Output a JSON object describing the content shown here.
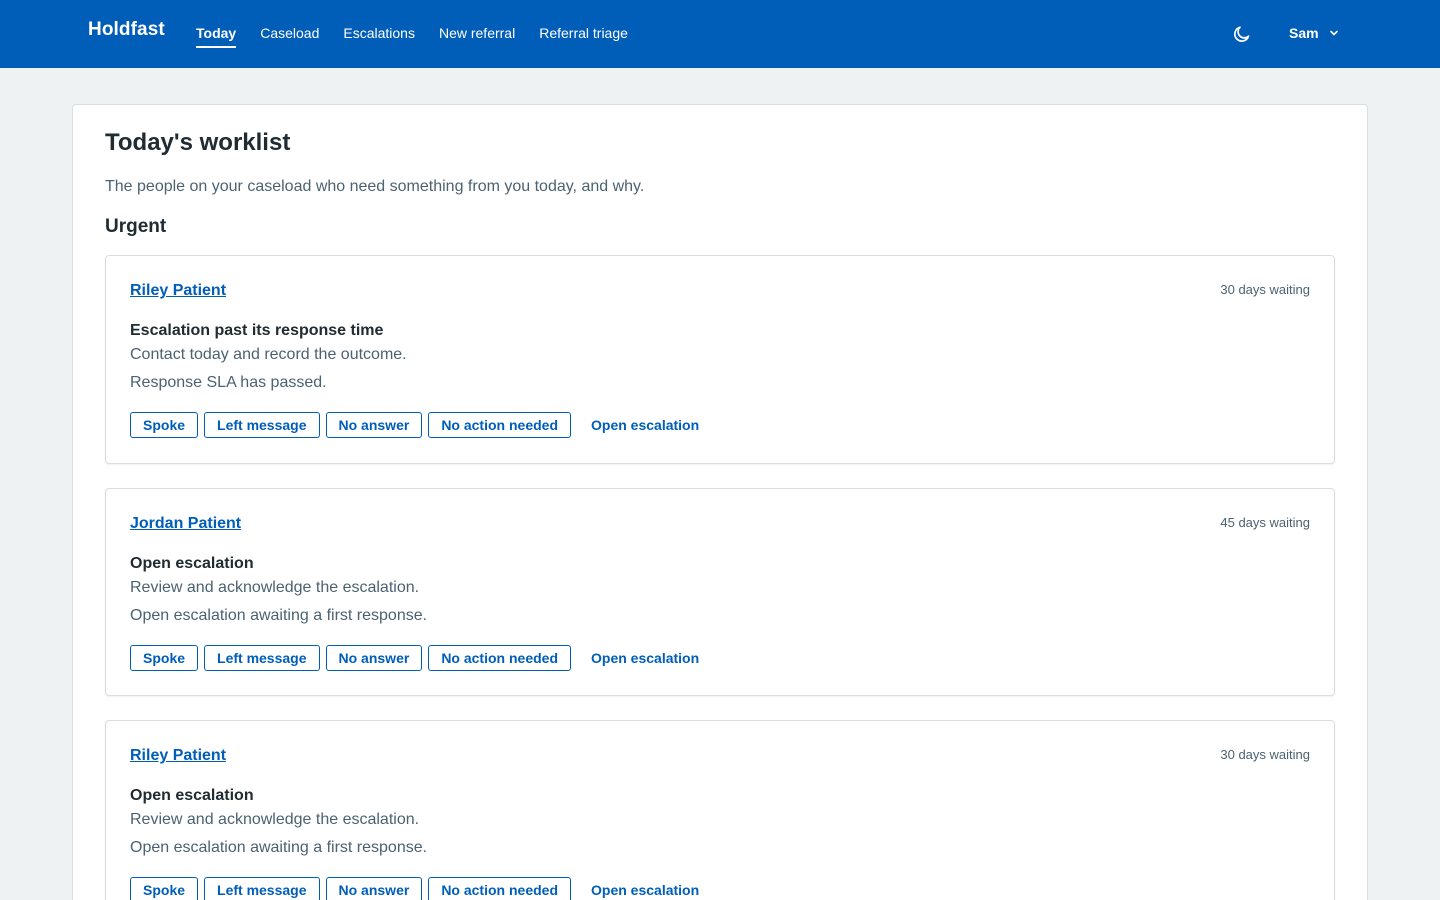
{
  "app": {
    "brand": "Holdfast"
  },
  "nav": {
    "items": [
      {
        "label": "Today",
        "active": true
      },
      {
        "label": "Caseload"
      },
      {
        "label": "Escalations"
      },
      {
        "label": "New referral"
      },
      {
        "label": "Referral triage"
      }
    ]
  },
  "header": {
    "theme_icon": "moon-icon",
    "user_name": "Sam",
    "user_menu_icon": "chevron-down-icon"
  },
  "page": {
    "title": "Today's worklist",
    "subtitle": "The people on your caseload who need something from you today, and why.",
    "section": "Urgent"
  },
  "outcome_labels": [
    "Spoke",
    "Left message",
    "No answer",
    "No action needed"
  ],
  "open_escalation_label": "Open escalation",
  "cards": [
    {
      "patient": "Riley Patient",
      "waiting": "30 days waiting",
      "reason": "Escalation past its response time",
      "action": "Contact today and record the outcome.",
      "detail": "Response SLA has passed."
    },
    {
      "patient": "Jordan Patient",
      "waiting": "45 days waiting",
      "reason": "Open escalation",
      "action": "Review and acknowledge the escalation.",
      "detail": "Open escalation awaiting a first response."
    },
    {
      "patient": "Riley Patient",
      "waiting": "30 days waiting",
      "reason": "Open escalation",
      "action": "Review and acknowledge the escalation.",
      "detail": "Open escalation awaiting a first response."
    }
  ],
  "colors": {
    "header": "#005eb8",
    "accent": "#005eb8",
    "background": "#eef2f3"
  }
}
